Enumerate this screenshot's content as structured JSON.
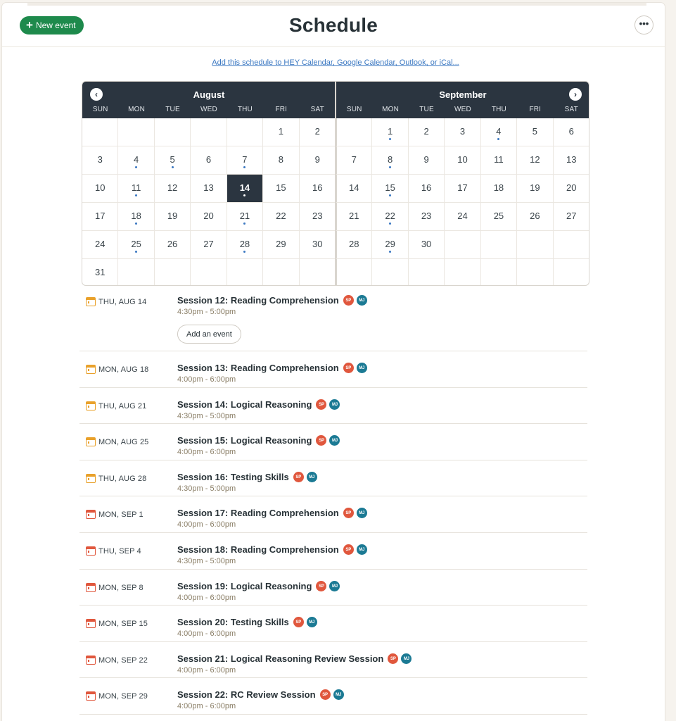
{
  "header": {
    "new_event_label": "New event",
    "title": "Schedule"
  },
  "subscribe_link": "Add this schedule to HEY Calendar, Google Calendar, Outlook, or iCal...",
  "calendar": {
    "weekdays": [
      "SUN",
      "MON",
      "TUE",
      "WED",
      "THU",
      "FRI",
      "SAT"
    ],
    "months": [
      {
        "name": "August",
        "weeks": [
          [
            "",
            "",
            "",
            "",
            "",
            "1",
            "2"
          ],
          [
            "3",
            "4",
            "5",
            "6",
            "7",
            "8",
            "9"
          ],
          [
            "10",
            "11",
            "12",
            "13",
            "14",
            "15",
            "16"
          ],
          [
            "17",
            "18",
            "19",
            "20",
            "21",
            "22",
            "23"
          ],
          [
            "24",
            "25",
            "26",
            "27",
            "28",
            "29",
            "30"
          ],
          [
            "31",
            "",
            "",
            "",
            "",
            "",
            ""
          ]
        ],
        "event_days": [
          "4",
          "5",
          "7",
          "11",
          "14",
          "18",
          "21",
          "25",
          "28"
        ],
        "today": "14"
      },
      {
        "name": "September",
        "weeks": [
          [
            "",
            "1",
            "2",
            "3",
            "4",
            "5",
            "6"
          ],
          [
            "7",
            "8",
            "9",
            "10",
            "11",
            "12",
            "13"
          ],
          [
            "14",
            "15",
            "16",
            "17",
            "18",
            "19",
            "20"
          ],
          [
            "21",
            "22",
            "23",
            "24",
            "25",
            "26",
            "27"
          ],
          [
            "28",
            "29",
            "30",
            "",
            "",
            "",
            ""
          ],
          [
            "",
            "",
            "",
            "",
            "",
            "",
            ""
          ]
        ],
        "event_days": [
          "1",
          "4",
          "8",
          "15",
          "22",
          "29"
        ],
        "today": ""
      }
    ]
  },
  "add_event_label": "Add an event",
  "avatars": {
    "sp": "SP",
    "mj": "MJ"
  },
  "colors": {
    "accent_green": "#1e8a4c",
    "august_icon": "#e9a12b",
    "september_icon": "#e0573d",
    "avatar_sp": "#e0573d",
    "avatar_mj": "#1b7a94",
    "dark": "#2b3540"
  },
  "events": [
    {
      "date": "THU, AUG 14",
      "month": "aug",
      "title": "Session 12: Reading Comprehension",
      "time": "4:30pm - 5:00pm",
      "today": true
    },
    {
      "date": "MON, AUG 18",
      "month": "aug",
      "title": "Session 13: Reading Comprehension",
      "time": "4:00pm - 6:00pm"
    },
    {
      "date": "THU, AUG 21",
      "month": "aug",
      "title": "Session 14: Logical Reasoning",
      "time": "4:30pm - 5:00pm"
    },
    {
      "date": "MON, AUG 25",
      "month": "aug",
      "title": "Session 15: Logical Reasoning",
      "time": "4:00pm - 6:00pm"
    },
    {
      "date": "THU, AUG 28",
      "month": "aug",
      "title": "Session 16: Testing Skills",
      "time": "4:30pm - 5:00pm"
    },
    {
      "date": "MON, SEP 1",
      "month": "sep",
      "title": "Session 17: Reading Comprehension",
      "time": "4:00pm - 6:00pm"
    },
    {
      "date": "THU, SEP 4",
      "month": "sep",
      "title": "Session 18: Reading Comprehension",
      "time": "4:30pm - 5:00pm"
    },
    {
      "date": "MON, SEP 8",
      "month": "sep",
      "title": "Session 19: Logical Reasoning",
      "time": "4:00pm - 6:00pm"
    },
    {
      "date": "MON, SEP 15",
      "month": "sep",
      "title": "Session 20: Testing Skills",
      "time": "4:00pm - 6:00pm"
    },
    {
      "date": "MON, SEP 22",
      "month": "sep",
      "title": "Session 21: Logical Reasoning Review Session",
      "time": "4:00pm - 6:00pm"
    },
    {
      "date": "MON, SEP 29",
      "month": "sep",
      "title": "Session 22: RC Review Session",
      "time": "4:00pm - 6:00pm"
    }
  ]
}
